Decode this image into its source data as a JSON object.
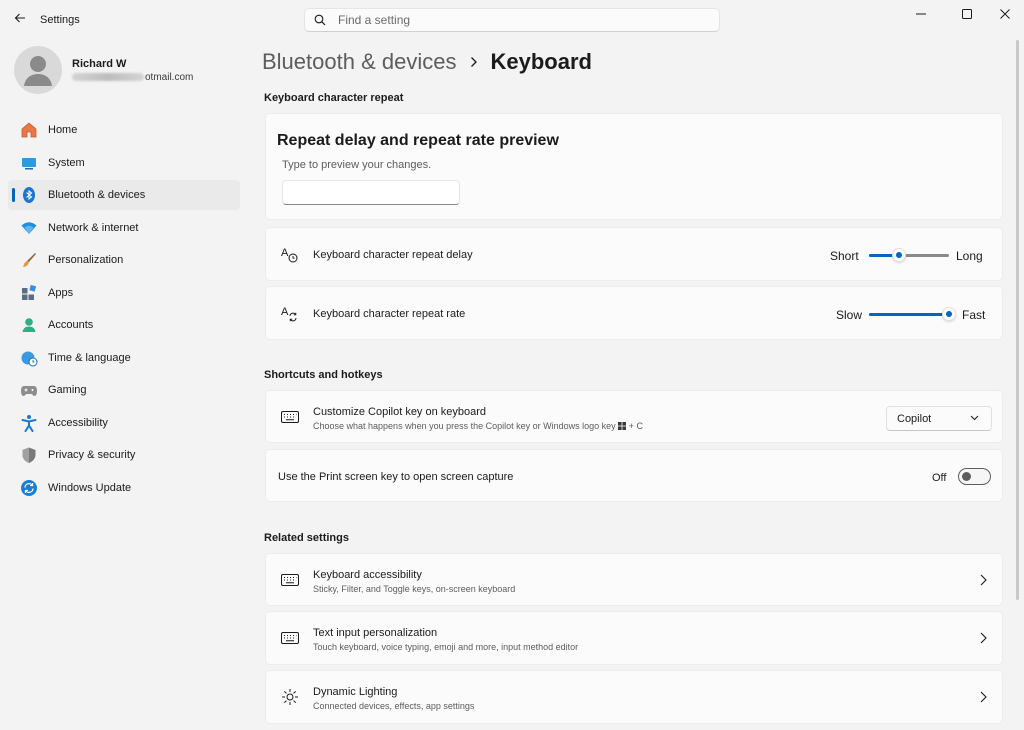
{
  "window": {
    "app_title": "Settings",
    "search_placeholder": "Find a setting"
  },
  "profile": {
    "name": "Richard W",
    "email_visible": "otmail.com"
  },
  "sidebar": {
    "items": [
      {
        "label": "Home",
        "icon": "home-icon",
        "color": "#e0652f"
      },
      {
        "label": "System",
        "icon": "system-icon",
        "color": "#0f8ad4"
      },
      {
        "label": "Bluetooth & devices",
        "icon": "bluetooth-icon",
        "color": "#0067c0",
        "active": true
      },
      {
        "label": "Network & internet",
        "icon": "wifi-icon",
        "color": "#1b8fd8"
      },
      {
        "label": "Personalization",
        "icon": "brush-icon",
        "color": "#d08730"
      },
      {
        "label": "Apps",
        "icon": "apps-icon",
        "color": "#5a6b7a"
      },
      {
        "label": "Accounts",
        "icon": "accounts-icon",
        "color": "#2aa07a"
      },
      {
        "label": "Time & language",
        "icon": "globe-clock-icon",
        "color": "#2b8ad6"
      },
      {
        "label": "Gaming",
        "icon": "gamepad-icon",
        "color": "#7a7a7a"
      },
      {
        "label": "Accessibility",
        "icon": "accessibility-icon",
        "color": "#1479cf"
      },
      {
        "label": "Privacy & security",
        "icon": "shield-icon",
        "color": "#6e6e6e"
      },
      {
        "label": "Windows Update",
        "icon": "update-icon",
        "color": "#1a7fd1"
      }
    ]
  },
  "breadcrumb": {
    "parent": "Bluetooth & devices",
    "current": "Keyboard"
  },
  "sections": {
    "repeat": "Keyboard character repeat",
    "shortcuts": "Shortcuts and hotkeys",
    "related": "Related settings"
  },
  "preview": {
    "heading": "Repeat delay and repeat rate preview",
    "hint": "Type to preview your changes.",
    "value": ""
  },
  "repeat_delay": {
    "title": "Keyboard character repeat delay",
    "min_label": "Short",
    "max_label": "Long",
    "value_fraction": 0.37
  },
  "repeat_rate": {
    "title": "Keyboard character repeat rate",
    "min_label": "Slow",
    "max_label": "Fast",
    "value_fraction": 1.0
  },
  "copilot": {
    "title": "Customize Copilot key on keyboard",
    "subtitle": "Choose what happens when you press the Copilot key or Windows logo key",
    "subtitle_suffix": "+ C",
    "selected": "Copilot"
  },
  "print_screen": {
    "title": "Use the Print screen key to open screen capture",
    "state": "Off",
    "on": false
  },
  "related": [
    {
      "title": "Keyboard accessibility",
      "subtitle": "Sticky, Filter, and Toggle keys, on-screen keyboard",
      "icon": "keyboard-icon"
    },
    {
      "title": "Text input personalization",
      "subtitle": "Touch keyboard, voice typing, emoji and more, input method editor",
      "icon": "keyboard-icon"
    },
    {
      "title": "Dynamic Lighting",
      "subtitle": "Connected devices, effects, app settings",
      "icon": "sun-icon"
    }
  ],
  "colors": {
    "accent": "#0067c0",
    "background": "#f3f3f3",
    "card": "#fbfbfb"
  }
}
